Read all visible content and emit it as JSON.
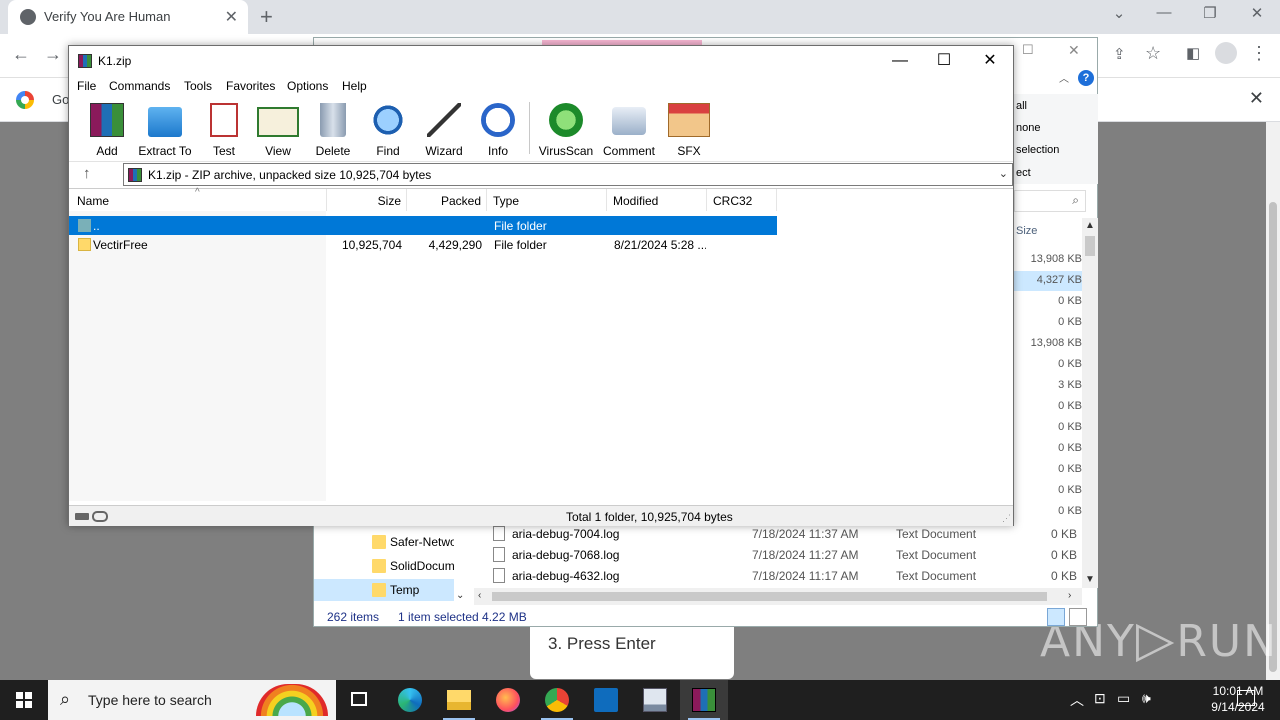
{
  "browser": {
    "tab_title": "Verify You Are Human",
    "new_tab_glyph": "+",
    "tab_close_glyph": "✕",
    "bookmark_text": "Go",
    "controls": {
      "chevron": "⌄",
      "minimize": "—",
      "restore": "❐",
      "close": "✕"
    },
    "infobar_close": "✕"
  },
  "instruction": {
    "step3": "3. Press Enter"
  },
  "watermark": {
    "left": "ANY",
    "right": "RUN"
  },
  "explorer": {
    "ribbon_items": [
      "all",
      "none",
      "selection",
      "ect"
    ],
    "size_header": "Size",
    "sizes": [
      "13,908 KB",
      "4,327 KB",
      "0 KB",
      "0 KB",
      "13,908 KB",
      "0 KB",
      "3 KB",
      "0 KB",
      "0 KB",
      "0 KB",
      "0 KB",
      "0 KB",
      "0 KB",
      "0 KB",
      "0 KB",
      "0 KB"
    ],
    "nav_items": [
      "Safer-Netwo",
      "SolidDocum",
      "Temp"
    ],
    "files": [
      {
        "name": "aria-debug-7004.log",
        "date": "7/18/2024 11:37 AM",
        "type": "Text Document",
        "size": "0 KB"
      },
      {
        "name": "aria-debug-7068.log",
        "date": "7/18/2024 11:27 AM",
        "type": "Text Document",
        "size": "0 KB"
      },
      {
        "name": "aria-debug-4632.log",
        "date": "7/18/2024 11:17 AM",
        "type": "Text Document",
        "size": "0 KB"
      }
    ],
    "status_count": "262 items",
    "status_selected": "1 item selected  4.22 MB"
  },
  "winrar": {
    "title": "K1.zip",
    "menu": [
      "File",
      "Commands",
      "Tools",
      "Favorites",
      "Options",
      "Help"
    ],
    "tools": [
      {
        "label": "Add",
        "icon": "add-archive-icon"
      },
      {
        "label": "Extract To",
        "icon": "extract-folder-icon"
      },
      {
        "label": "Test",
        "icon": "test-clipboard-icon"
      },
      {
        "label": "View",
        "icon": "view-book-icon"
      },
      {
        "label": "Delete",
        "icon": "trash-icon"
      },
      {
        "label": "Find",
        "icon": "magnifier-icon"
      },
      {
        "label": "Wizard",
        "icon": "magic-wand-icon"
      },
      {
        "label": "Info",
        "icon": "info-icon"
      },
      {
        "label": "VirusScan",
        "icon": "virus-scan-icon"
      },
      {
        "label": "Comment",
        "icon": "comment-icon"
      },
      {
        "label": "SFX",
        "icon": "sfx-box-icon"
      }
    ],
    "path": "K1.zip - ZIP archive, unpacked size 10,925,704 bytes",
    "columns": [
      "Name",
      "Size",
      "Packed",
      "Type",
      "Modified",
      "CRC32"
    ],
    "rows": [
      {
        "name": "..",
        "size": "",
        "packed": "",
        "type": "File folder",
        "modified": "",
        "crc": ""
      },
      {
        "name": "VectirFree",
        "size": "10,925,704",
        "packed": "4,429,290",
        "type": "File folder",
        "modified": "8/21/2024 5:28 ...",
        "crc": ""
      }
    ],
    "status": "Total 1 folder, 10,925,704 bytes"
  },
  "taskbar": {
    "search_placeholder": "Type here to search",
    "time": "10:01 AM",
    "date": "9/14/2024",
    "apps": [
      "task-view-icon",
      "edge-icon",
      "file-explorer-icon",
      "firefox-icon",
      "chrome-icon",
      "outlook-icon",
      "computer-icon",
      "winrar-icon"
    ]
  },
  "colors": {
    "selection_blue": "#0078d7",
    "taskbar": "#1f1f1f",
    "page_overlay": "#7f7f7f"
  }
}
